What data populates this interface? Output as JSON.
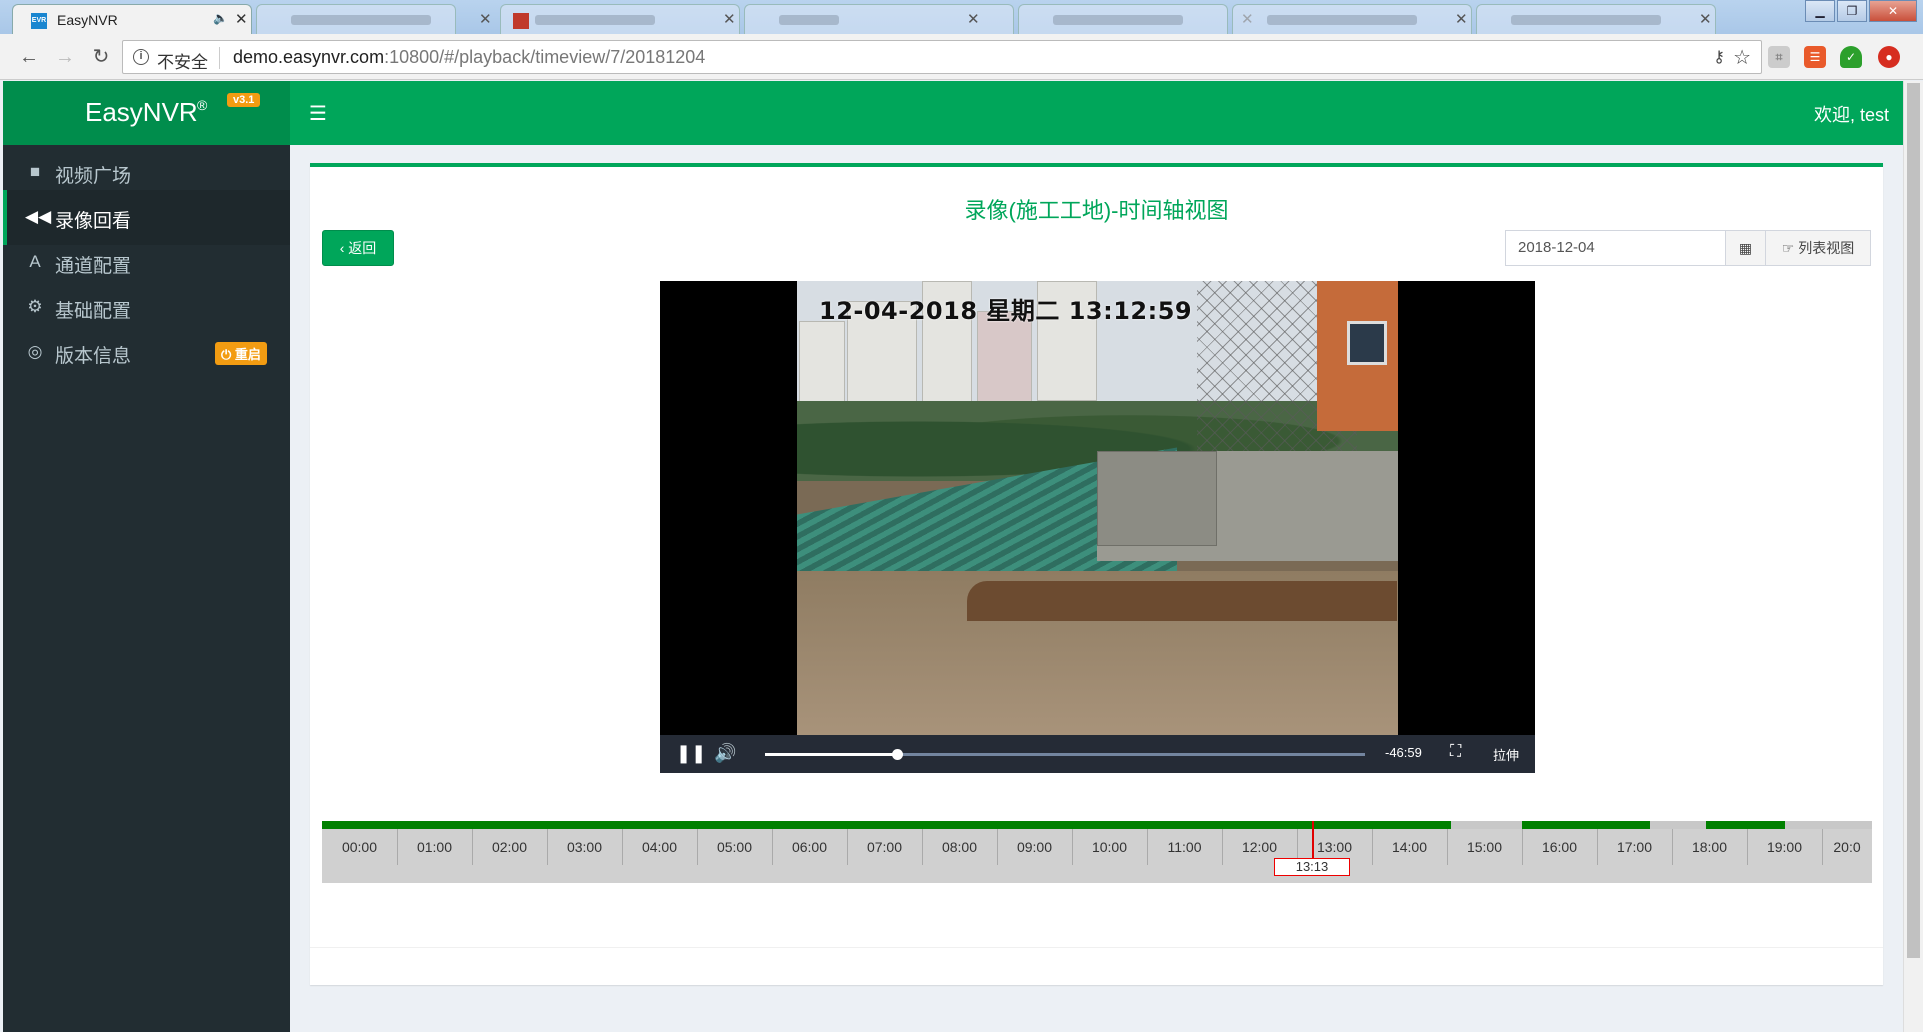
{
  "browser": {
    "active_tab_title": "EasyNVR",
    "insecure_label": "不安全",
    "url_host": "demo.easynvr.com",
    "url_path": ":10800/#/playback/timeview/7/20181204"
  },
  "header": {
    "logo": "EasyNVR",
    "logo_mark": "®",
    "version_badge": "v3.1",
    "welcome": "欢迎, test"
  },
  "sidebar": {
    "items": [
      {
        "label": "视频广场",
        "icon": "video-camera-icon"
      },
      {
        "label": "录像回看",
        "icon": "backward-icon",
        "active": true
      },
      {
        "label": "通道配置",
        "icon": "road-icon"
      },
      {
        "label": "基础配置",
        "icon": "cogs-icon"
      },
      {
        "label": "版本信息",
        "icon": "support-icon",
        "badge": "重启"
      }
    ]
  },
  "main": {
    "title": "录像(施工工地)-时间轴视图",
    "back_button": "返回",
    "date_value": "2018-12-04",
    "list_view_button": "列表视图"
  },
  "player": {
    "osd_text": "12-04-2018  星期二  13:12:59",
    "remaining_time": "-46:59",
    "stretch_label": "拉伸",
    "progress": 0.22
  },
  "timeline": {
    "hours": [
      "00:00",
      "01:00",
      "02:00",
      "03:00",
      "04:00",
      "05:00",
      "06:00",
      "07:00",
      "08:00",
      "09:00",
      "10:00",
      "11:00",
      "12:00",
      "13:00",
      "14:00",
      "15:00",
      "16:00",
      "17:00",
      "18:00",
      "19:00",
      "20:0"
    ],
    "cursor_label": "13:13",
    "cursor_hour": 13.2,
    "recorded_segments": [
      [
        0,
        15.05
      ],
      [
        16.0,
        17.7
      ],
      [
        18.45,
        19.5
      ]
    ],
    "colors": {
      "recorded": "#008000",
      "cursor": "#e00000"
    }
  },
  "colors": {
    "brand": "#00a65a",
    "sidebar_bg": "#222d32",
    "badge": "#f39c12"
  }
}
